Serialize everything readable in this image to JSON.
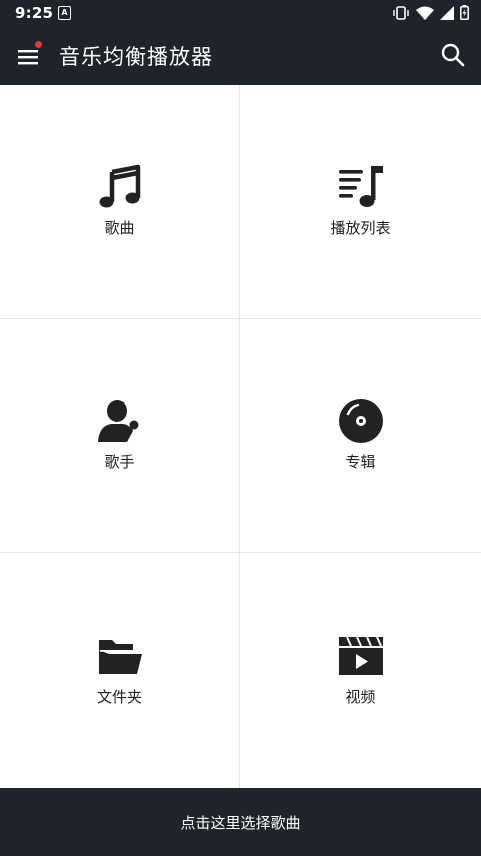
{
  "status": {
    "time": "9:25",
    "notification_glyph": "A",
    "icons": [
      "vibrate-icon",
      "wifi-icon",
      "signal-icon",
      "battery-icon"
    ]
  },
  "appbar": {
    "title": "音乐均衡播放器",
    "menu_icon": "menu-icon",
    "search_icon": "search-icon",
    "badge_color": "#e53935"
  },
  "grid": [
    {
      "id": "songs",
      "label": "歌曲",
      "icon": "music-note-icon"
    },
    {
      "id": "playlist",
      "label": "播放列表",
      "icon": "playlist-icon"
    },
    {
      "id": "artists",
      "label": "歌手",
      "icon": "singer-icon"
    },
    {
      "id": "albums",
      "label": "专辑",
      "icon": "disc-icon"
    },
    {
      "id": "folders",
      "label": "文件夹",
      "icon": "folder-icon"
    },
    {
      "id": "videos",
      "label": "视频",
      "icon": "video-icon"
    }
  ],
  "bottom_bar": {
    "label": "点击这里选择歌曲"
  },
  "colors": {
    "bar_bg": "#1f232a",
    "icon": "#222222",
    "divider": "#e6e6e6"
  }
}
